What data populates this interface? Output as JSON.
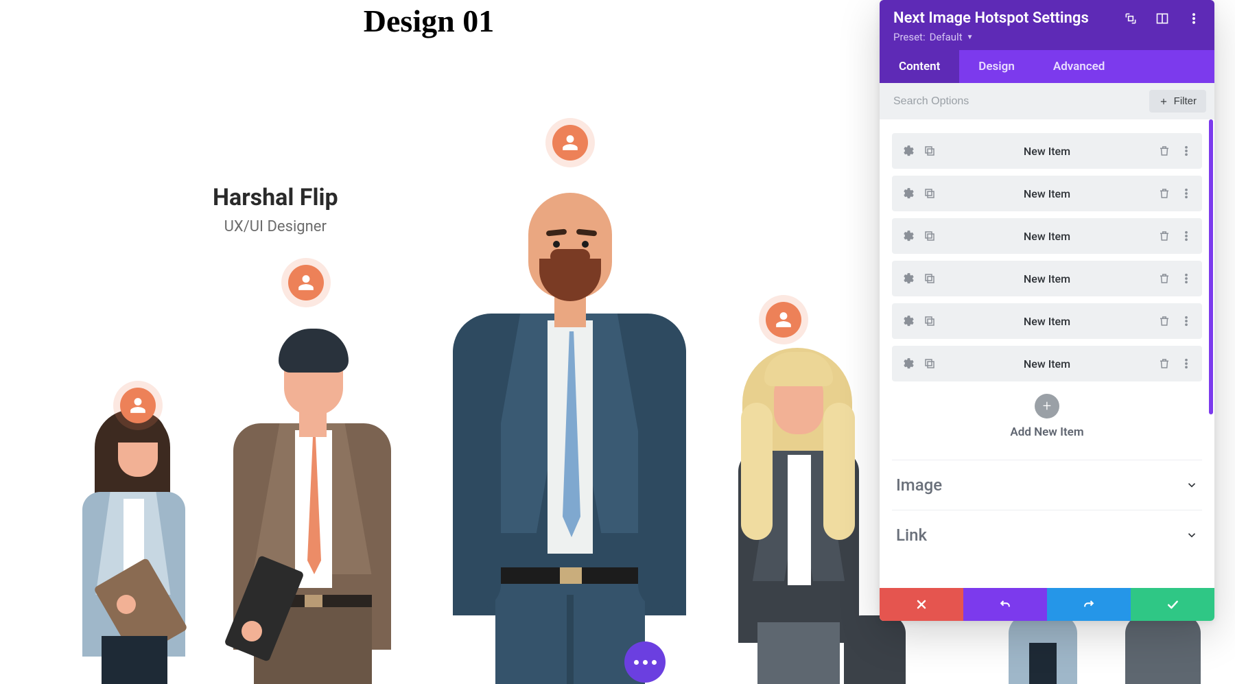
{
  "canvas": {
    "title": "Design 01",
    "tooltip": {
      "name": "Harshal Flip",
      "role": "UX/UI Designer"
    }
  },
  "panel": {
    "title": "Next Image Hotspot Settings",
    "preset_label": "Preset:",
    "preset_value": "Default",
    "tabs": {
      "content": "Content",
      "design": "Design",
      "advanced": "Advanced"
    },
    "search_placeholder": "Search Options",
    "filter_label": "Filter",
    "items": [
      {
        "label": "New Item"
      },
      {
        "label": "New Item"
      },
      {
        "label": "New Item"
      },
      {
        "label": "New Item"
      },
      {
        "label": "New Item"
      },
      {
        "label": "New Item"
      }
    ],
    "add_label": "Add New Item",
    "sections": {
      "image": "Image",
      "link": "Link"
    }
  }
}
